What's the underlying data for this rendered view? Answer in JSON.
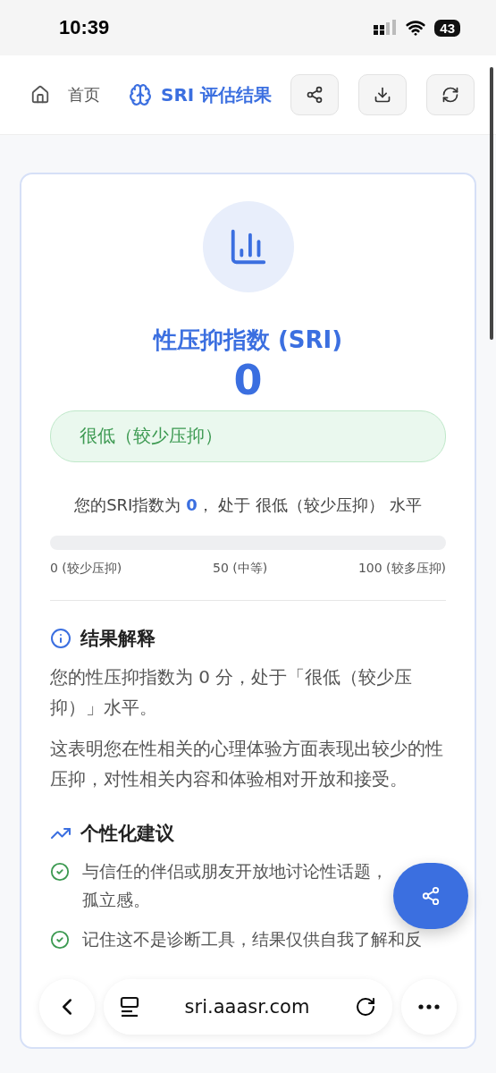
{
  "status_bar": {
    "time": "10:39",
    "battery": "43"
  },
  "header": {
    "home": "首页",
    "title": "SRI 评估结果"
  },
  "result": {
    "title": "性压抑指数 (SRI)",
    "score": "0",
    "level_badge": "很低（较少压抑）",
    "summary": {
      "prefix": "您的SRI指数为",
      "score": "0",
      "middle": "， 处于",
      "level": "很低（较少压抑）",
      "suffix": "水平"
    },
    "meter": {
      "level": 0,
      "labels": [
        "0 (较少压抑)",
        "50 (中等)",
        "100 (较多压抑)"
      ]
    }
  },
  "sections": [
    {
      "kind": "info",
      "title": "结果解释",
      "paragraphs": [
        "您的性压抑指数为 0 分，处于「很低（较少压抑）」水平。",
        "这表明您在性相关的心理体验方面表现出较少的性压抑，对性相关内容和体验相对开放和接受。"
      ]
    },
    {
      "kind": "tips",
      "title": "个性化建议",
      "items": [
        {
          "lines": [
            "与信任的伴侣或朋友开放地讨论性话题，",
            "孤立感。"
          ]
        },
        {
          "lines": [
            "记住这不是诊断工具，结果仅供自我了解和反"
          ]
        }
      ]
    }
  ],
  "browser": {
    "url": "sri.aaasr.com"
  }
}
